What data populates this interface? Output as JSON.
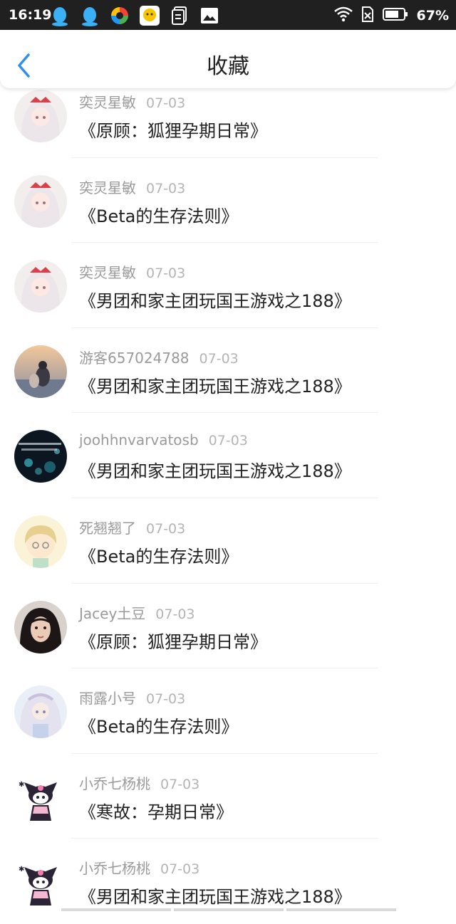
{
  "status_bar": {
    "time": "16:19",
    "battery": "67%"
  },
  "header": {
    "title": "收藏"
  },
  "items": [
    {
      "user": "奕灵星敏",
      "date": "07-03",
      "book": "《原顾：狐狸孕期日常》",
      "avatar": "anime-girl-white"
    },
    {
      "user": "奕灵星敏",
      "date": "07-03",
      "book": "《Beta的生存法则》",
      "avatar": "anime-girl-white"
    },
    {
      "user": "奕灵星敏",
      "date": "07-03",
      "book": "《男团和家主团玩国王游戏之188》",
      "avatar": "anime-girl-white"
    },
    {
      "user": "游客657024788",
      "date": "07-03",
      "book": "《男团和家主团玩国王游戏之188》",
      "avatar": "couple-sunset"
    },
    {
      "user": "joohhnvarvatosb",
      "date": "07-03",
      "book": "《男团和家主团玩国王游戏之188》",
      "avatar": "dark-bokeh"
    },
    {
      "user": "死翘翘了",
      "date": "07-03",
      "book": "《Beta的生存法则》",
      "avatar": "anime-boy-blonde"
    },
    {
      "user": "Jacey土豆",
      "date": "07-03",
      "book": "《原顾：狐狸孕期日常》",
      "avatar": "woman-portrait"
    },
    {
      "user": "雨露小号",
      "date": "07-03",
      "book": "《Beta的生存法则》",
      "avatar": "anime-girl-pastel"
    },
    {
      "user": "小乔七杨桃",
      "date": "07-03",
      "book": "《寒故：孕期日常》",
      "avatar": "kuromi"
    },
    {
      "user": "小乔七杨桃",
      "date": "07-03",
      "book": "《男团和家主团玩国王游戏之188》",
      "avatar": "kuromi"
    }
  ],
  "colors": {
    "accent": "#2f8ff0",
    "status_bg": "#202020",
    "meta_text": "#9a9a9a",
    "title_text": "#222222"
  }
}
